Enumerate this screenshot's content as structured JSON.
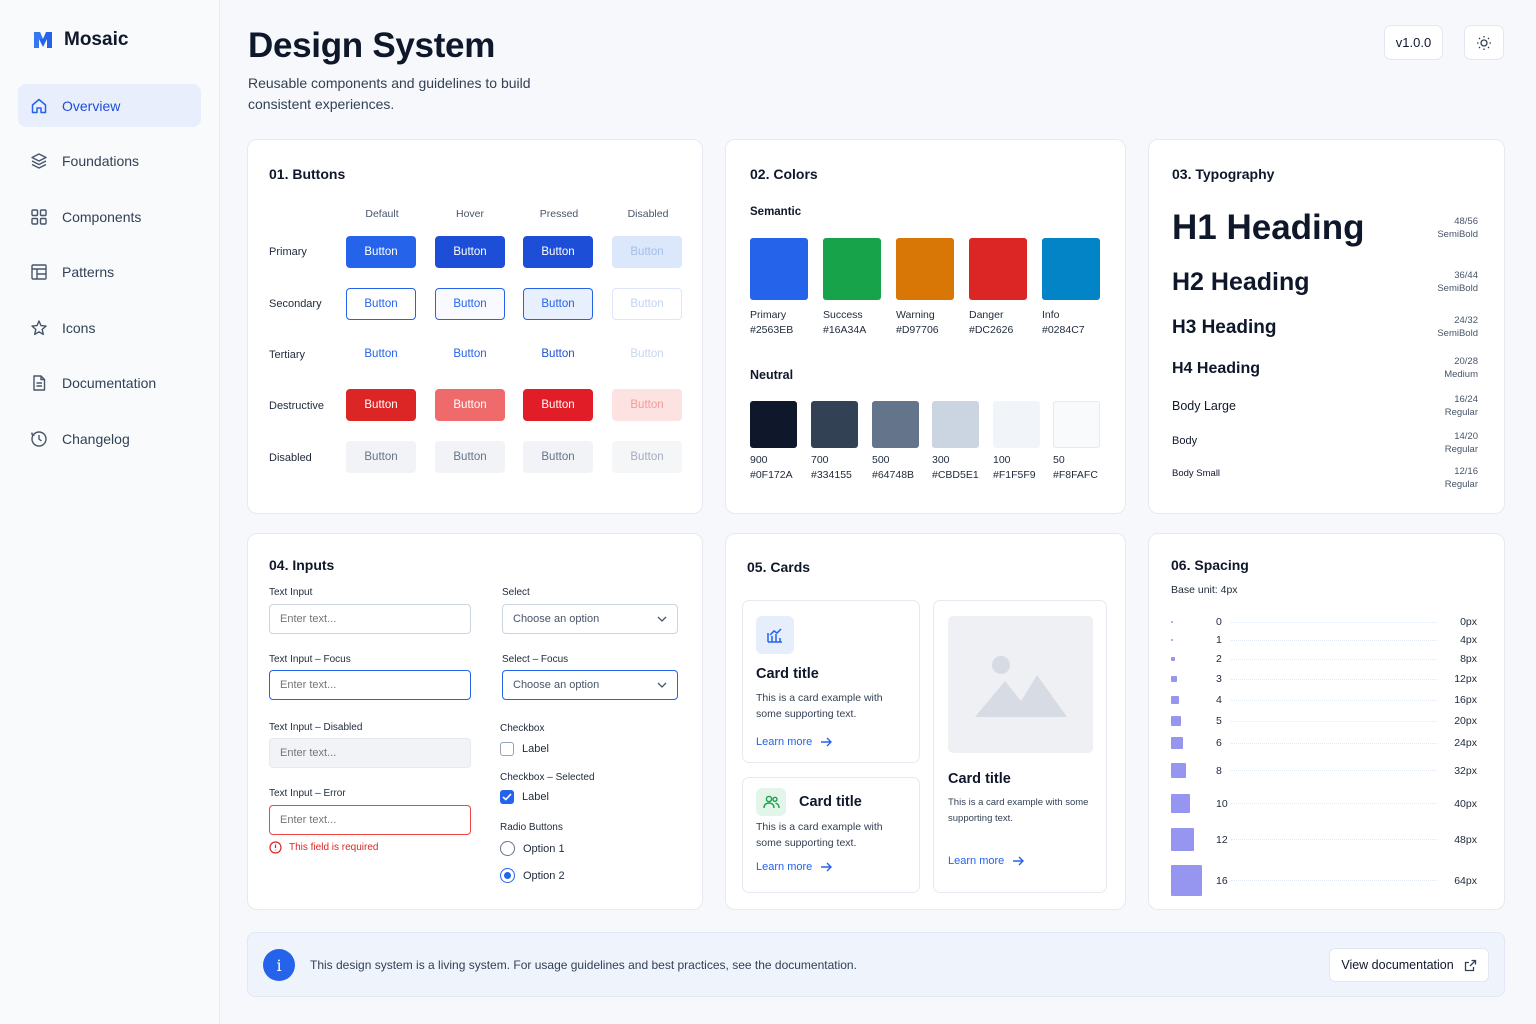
{
  "brand": {
    "name": "Mosaic"
  },
  "nav": [
    {
      "label": "Overview",
      "icon": "home-icon",
      "active": true
    },
    {
      "label": "Foundations",
      "icon": "layers-icon"
    },
    {
      "label": "Components",
      "icon": "grid-icon"
    },
    {
      "label": "Patterns",
      "icon": "layout-icon"
    },
    {
      "label": "Icons",
      "icon": "star-icon"
    },
    {
      "label": "Documentation",
      "icon": "file-icon"
    },
    {
      "label": "Changelog",
      "icon": "clock-icon"
    }
  ],
  "header": {
    "title": "Design System",
    "subtitle": "Reusable components and guidelines to build consistent experiences.",
    "version": "v1.0.0"
  },
  "buttons": {
    "title": "01. Buttons",
    "states": [
      "Default",
      "Hover",
      "Pressed",
      "Disabled"
    ],
    "rows": [
      "Primary",
      "Secondary",
      "Tertiary",
      "Destructive",
      "Disabled"
    ],
    "label": "Button"
  },
  "colors": {
    "title": "02. Colors",
    "semantic_title": "Semantic",
    "semantic": [
      {
        "name": "Primary",
        "hex": "#2563EB"
      },
      {
        "name": "Success",
        "hex": "#16A34A"
      },
      {
        "name": "Warning",
        "hex": "#D97706"
      },
      {
        "name": "Danger",
        "hex": "#DC2626"
      },
      {
        "name": "Info",
        "hex": "#0284C7"
      }
    ],
    "neutral_title": "Neutral",
    "neutral": [
      {
        "name": "900",
        "hex": "#0F172A"
      },
      {
        "name": "700",
        "hex": "#334155"
      },
      {
        "name": "500",
        "hex": "#64748B"
      },
      {
        "name": "300",
        "hex": "#CBD5E1"
      },
      {
        "name": "100",
        "hex": "#F1F5F9"
      },
      {
        "name": "50",
        "hex": "#F8FAFC"
      }
    ]
  },
  "typography": {
    "title": "03. Typography",
    "items": [
      {
        "name": "H1 Heading",
        "size": "48/56",
        "weight": "SemiBold"
      },
      {
        "name": "H2 Heading",
        "size": "36/44",
        "weight": "SemiBold"
      },
      {
        "name": "H3 Heading",
        "size": "24/32",
        "weight": "SemiBold"
      },
      {
        "name": "H4 Heading",
        "size": "20/28",
        "weight": "Medium"
      },
      {
        "name": "Body Large",
        "size": "16/24",
        "weight": "Regular"
      },
      {
        "name": "Body",
        "size": "14/20",
        "weight": "Regular"
      },
      {
        "name": "Body Small",
        "size": "12/16",
        "weight": "Regular"
      }
    ]
  },
  "inputs": {
    "title": "04. Inputs",
    "text_input": "Text Input",
    "text_input_focus": "Text Input – Focus",
    "text_input_disabled": "Text Input – Disabled",
    "text_input_error": "Text Input – Error",
    "placeholder": "Enter text...",
    "error_msg": "This field is required",
    "select": "Select",
    "select_focus": "Select – Focus",
    "select_placeholder": "Choose an option",
    "checkbox": "Checkbox",
    "checkbox_selected": "Checkbox – Selected",
    "checkbox_label": "Label",
    "radio": "Radio Buttons",
    "option1": "Option 1",
    "option2": "Option 2"
  },
  "cards": {
    "title": "05. Cards",
    "card_title": "Card title",
    "card_text": "This is a card example with some supporting text.",
    "learn_more": "Learn more"
  },
  "spacing": {
    "title": "06. Spacing",
    "base": "Base unit: 4px",
    "rows": [
      {
        "token": "0",
        "value": "0px"
      },
      {
        "token": "1",
        "value": "4px"
      },
      {
        "token": "2",
        "value": "8px"
      },
      {
        "token": "3",
        "value": "12px"
      },
      {
        "token": "4",
        "value": "16px"
      },
      {
        "token": "5",
        "value": "20px"
      },
      {
        "token": "6",
        "value": "24px"
      },
      {
        "token": "8",
        "value": "32px"
      },
      {
        "token": "10",
        "value": "40px"
      },
      {
        "token": "12",
        "value": "48px"
      },
      {
        "token": "16",
        "value": "64px"
      }
    ]
  },
  "banner": {
    "text": "This design system is a living system. For usage guidelines and best practices, see the documentation.",
    "button": "View documentation"
  }
}
